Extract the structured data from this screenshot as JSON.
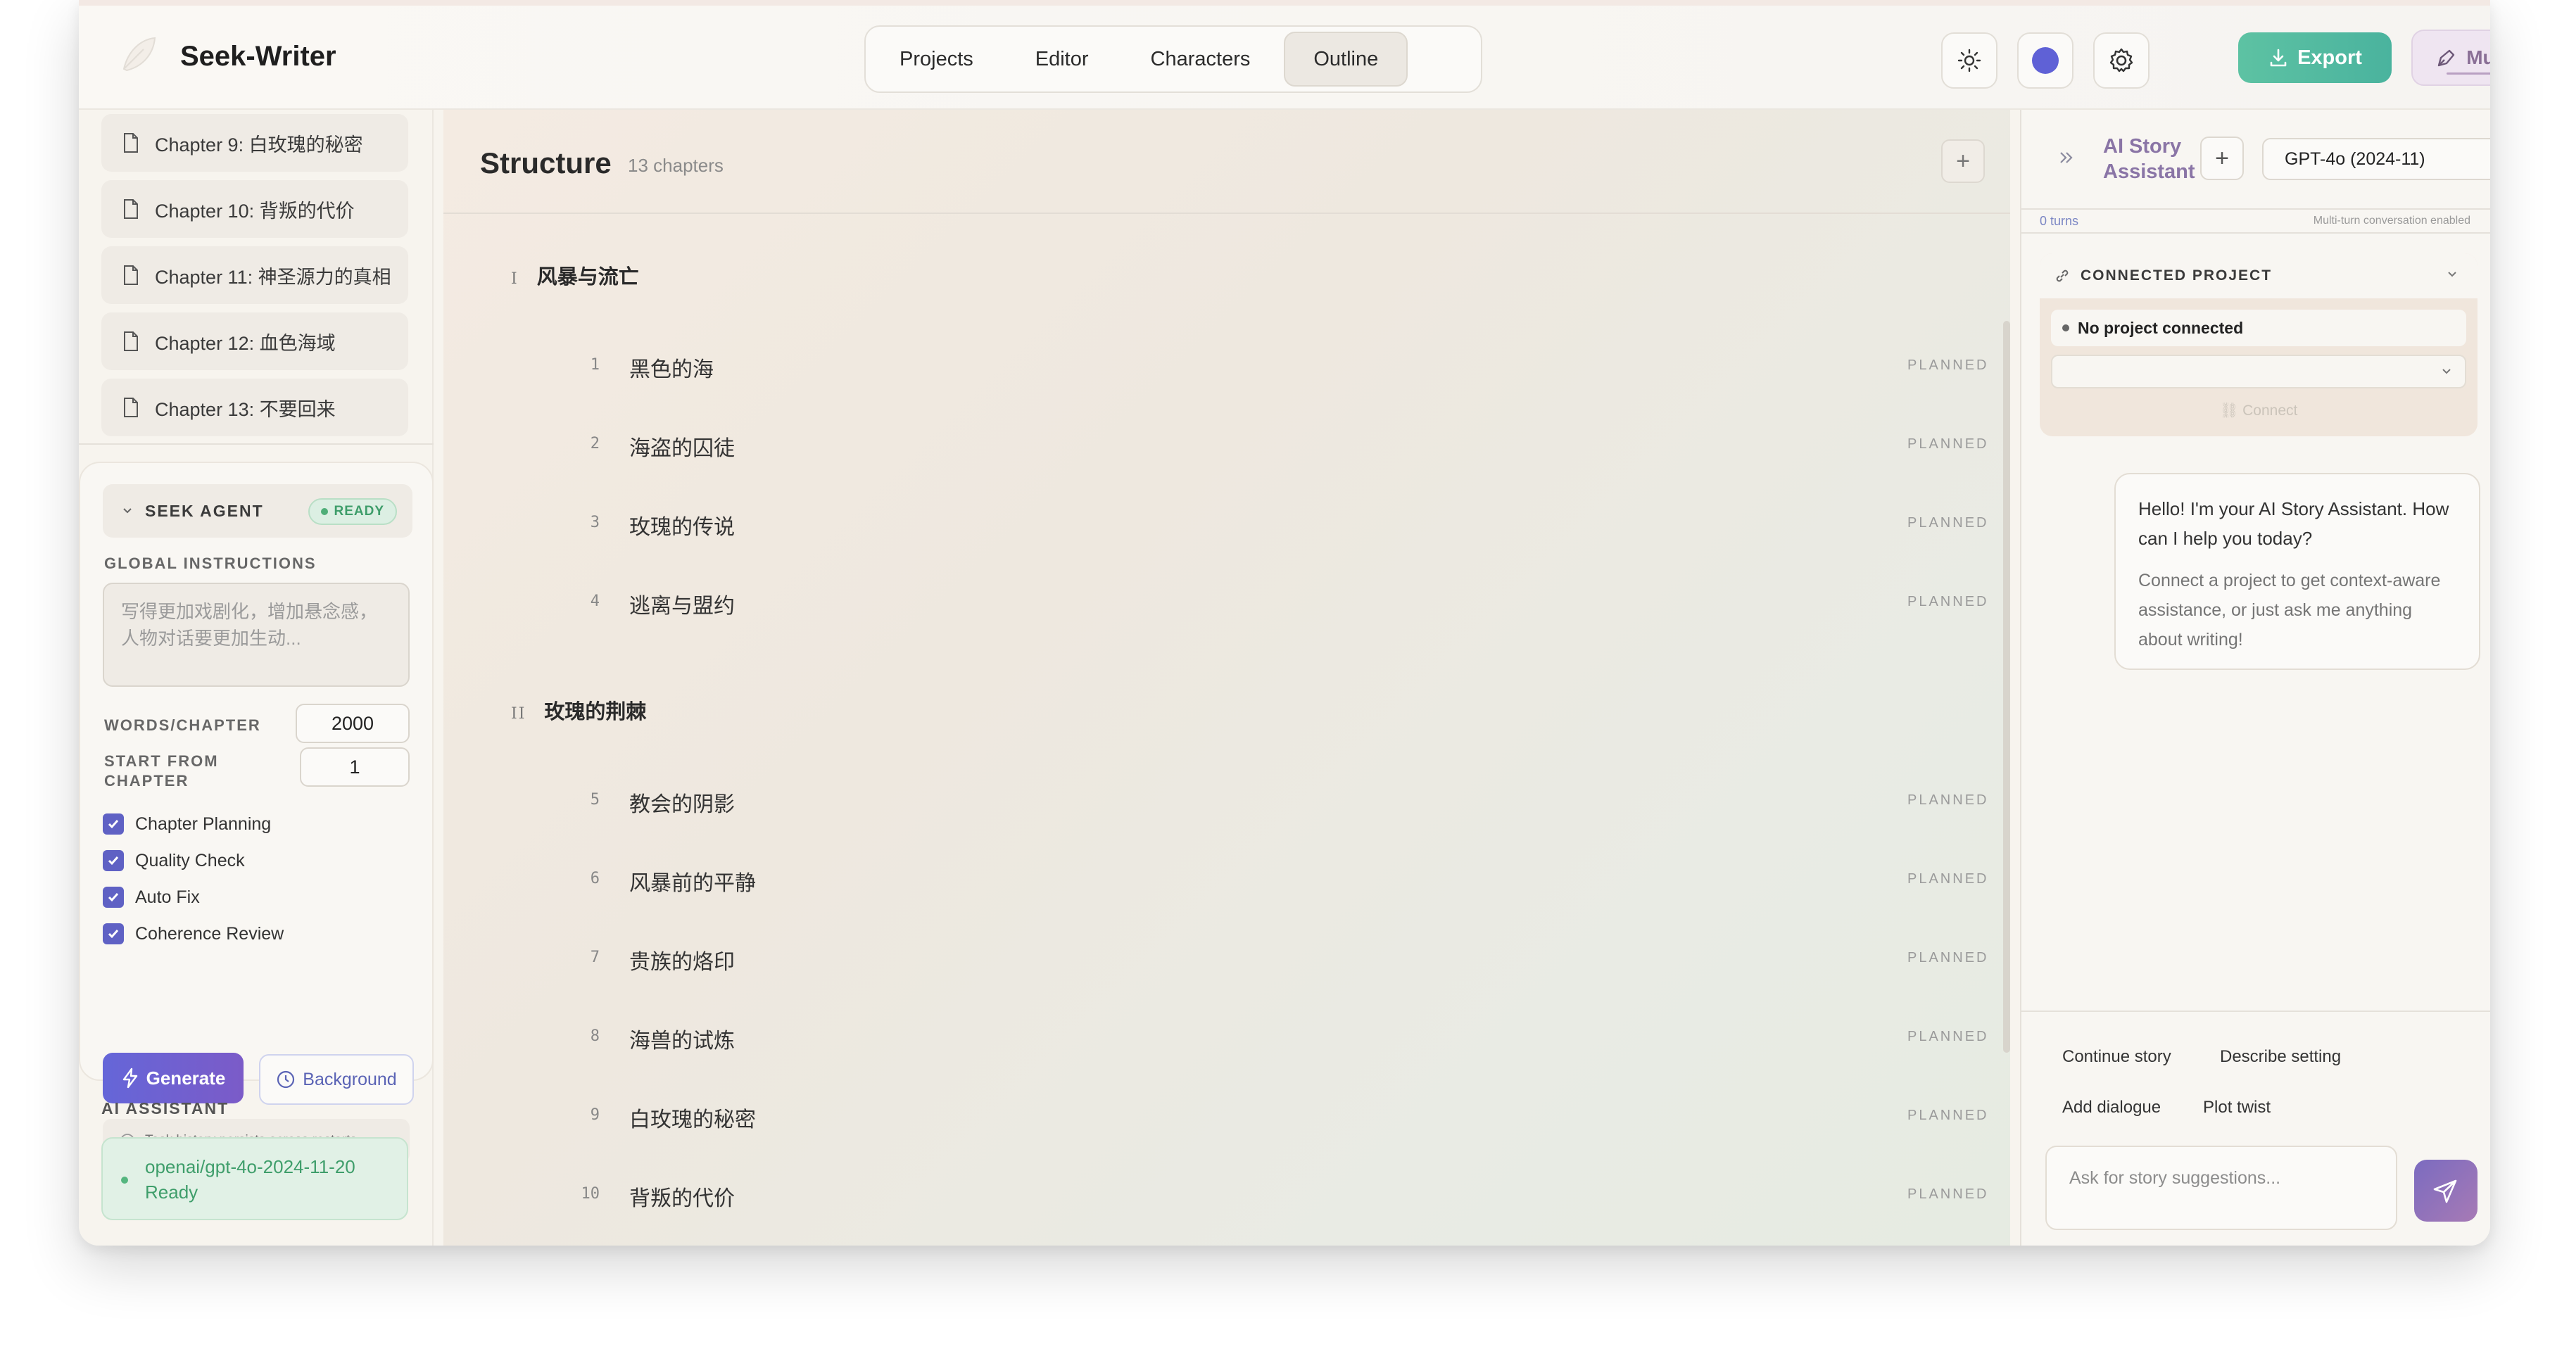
{
  "app": {
    "title": "Seek-Writer"
  },
  "nav": {
    "tabs": [
      {
        "label": "Projects"
      },
      {
        "label": "Editor"
      },
      {
        "label": "Characters"
      },
      {
        "label": "Outline",
        "active": true
      }
    ]
  },
  "toolbar": {
    "export_label": "Export",
    "muse_label": "Muse"
  },
  "colors": {
    "accent_green": "#4ab39e",
    "accent_purple": "#6566d8",
    "muse_purple": "#8a6f96",
    "theme_dot": "#5f61d6"
  },
  "sidebar": {
    "chapters": [
      "Chapter 9: 白玫瑰的秘密",
      "Chapter 10: 背叛的代价",
      "Chapter 11: 神圣源力的真相",
      "Chapter 12: 血色海域",
      "Chapter 13: 不要回来"
    ],
    "agent": {
      "title": "SEEK AGENT",
      "status": "READY",
      "instructions_label": "GLOBAL INSTRUCTIONS",
      "instructions_placeholder": "写得更加戏剧化，增加悬念感，人物对话要更加生动...",
      "words_label": "WORDS/CHAPTER",
      "words_value": "2000",
      "start_label": "START FROM CHAPTER",
      "start_value": "1",
      "options": [
        "Chapter Planning",
        "Quality Check",
        "Auto Fix",
        "Coherence Review"
      ],
      "generate_label": "Generate",
      "background_label": "Background",
      "history_note": "Task history persists across restarts"
    },
    "ai_assistant": {
      "label": "AI ASSISTANT",
      "model": "openai/gpt-4o-2024-11-20",
      "status": "Ready"
    }
  },
  "main": {
    "title": "Structure",
    "count": "13 chapters",
    "sections": [
      {
        "numeral": "I",
        "title": "风暴与流亡",
        "chapters": [
          {
            "num": "1",
            "title": "黑色的海",
            "status": "PLANNED"
          },
          {
            "num": "2",
            "title": "海盗的囚徒",
            "status": "PLANNED"
          },
          {
            "num": "3",
            "title": "玫瑰的传说",
            "status": "PLANNED"
          },
          {
            "num": "4",
            "title": "逃离与盟约",
            "status": "PLANNED"
          }
        ]
      },
      {
        "numeral": "II",
        "title": "玫瑰的荆棘",
        "chapters": [
          {
            "num": "5",
            "title": "教会的阴影",
            "status": "PLANNED"
          },
          {
            "num": "6",
            "title": "风暴前的平静",
            "status": "PLANNED"
          },
          {
            "num": "7",
            "title": "贵族的烙印",
            "status": "PLANNED"
          },
          {
            "num": "8",
            "title": "海兽的试炼",
            "status": "PLANNED"
          },
          {
            "num": "9",
            "title": "白玫瑰的秘密",
            "status": "PLANNED"
          },
          {
            "num": "10",
            "title": "背叛的代价",
            "status": "PLANNED"
          }
        ]
      }
    ]
  },
  "assistant": {
    "title_line1": "AI Story",
    "title_line2": "Assistant",
    "model_select": "GPT-4o (2024-11)",
    "turns": "0 turns",
    "multi_turn_note": "Multi-turn conversation enabled",
    "connected_project_label": "CONNECTED PROJECT",
    "no_project": "No project connected",
    "connect_label": "Connect",
    "greeting": "Hello! I'm your AI Story Assistant. How can I help you today?",
    "greeting_hint": "Connect a project to get context-aware assistance, or just ask me anything about writing!",
    "suggestions": [
      "Continue story",
      "Describe setting",
      "Add dialogue",
      "Plot twist"
    ],
    "input_placeholder": "Ask for story suggestions..."
  }
}
